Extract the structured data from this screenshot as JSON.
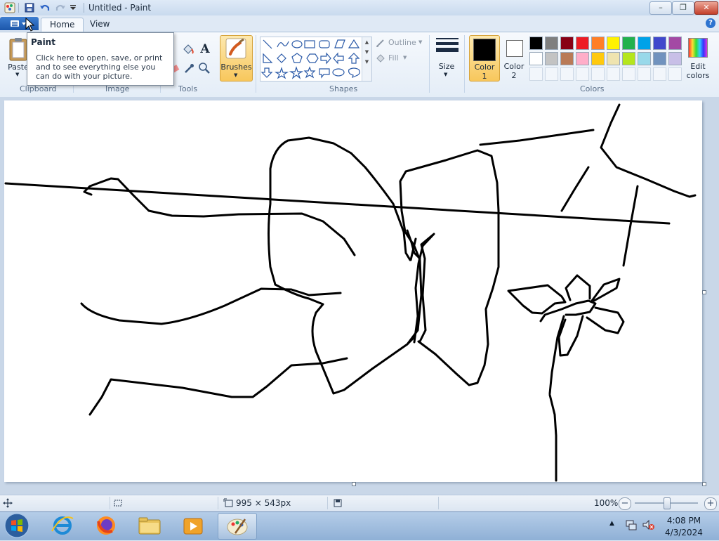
{
  "window": {
    "title": "Untitled - Paint",
    "minimize": "–",
    "maximize": "❐",
    "close": "✕",
    "help": "?"
  },
  "tabs": {
    "home": "Home",
    "view": "View"
  },
  "tooltip": {
    "title": "Paint",
    "body": "Click here to open, save, or print and to see everything else you can do with your picture."
  },
  "ribbon": {
    "paste_label": "Paste",
    "tools_text_glyph": "A",
    "brushes_label": "Brushes",
    "outline_label": "Outline",
    "fill_label": "Fill",
    "size_label": "Size",
    "color1_label": "Color",
    "color1_num": "1",
    "color2_label": "Color",
    "color2_num": "2",
    "edit_colors_label": "Edit",
    "edit_colors_label2": "colors",
    "groups": {
      "clipboard": "Clipboard",
      "image": "Image",
      "tools": "Tools",
      "shapes": "Shapes",
      "colors": "Colors"
    },
    "color1_value": "#000000",
    "color2_value": "#ffffff",
    "palette_row1": [
      "#000000",
      "#7f7f7f",
      "#880015",
      "#ed1c24",
      "#ff7f27",
      "#fff200",
      "#22b14c",
      "#00a2e8",
      "#3f48cc",
      "#a349a4"
    ],
    "palette_row2": [
      "#ffffff",
      "#c3c3c3",
      "#b97a57",
      "#ffaec9",
      "#ffc90e",
      "#efe4b0",
      "#b5e61d",
      "#99d9ea",
      "#7092be",
      "#c8bfe7"
    ]
  },
  "status": {
    "canvas_size": "995 × 543px",
    "zoom": "100%"
  },
  "taskbar": {
    "time": "4:08 PM",
    "date": "4/3/2024"
  }
}
